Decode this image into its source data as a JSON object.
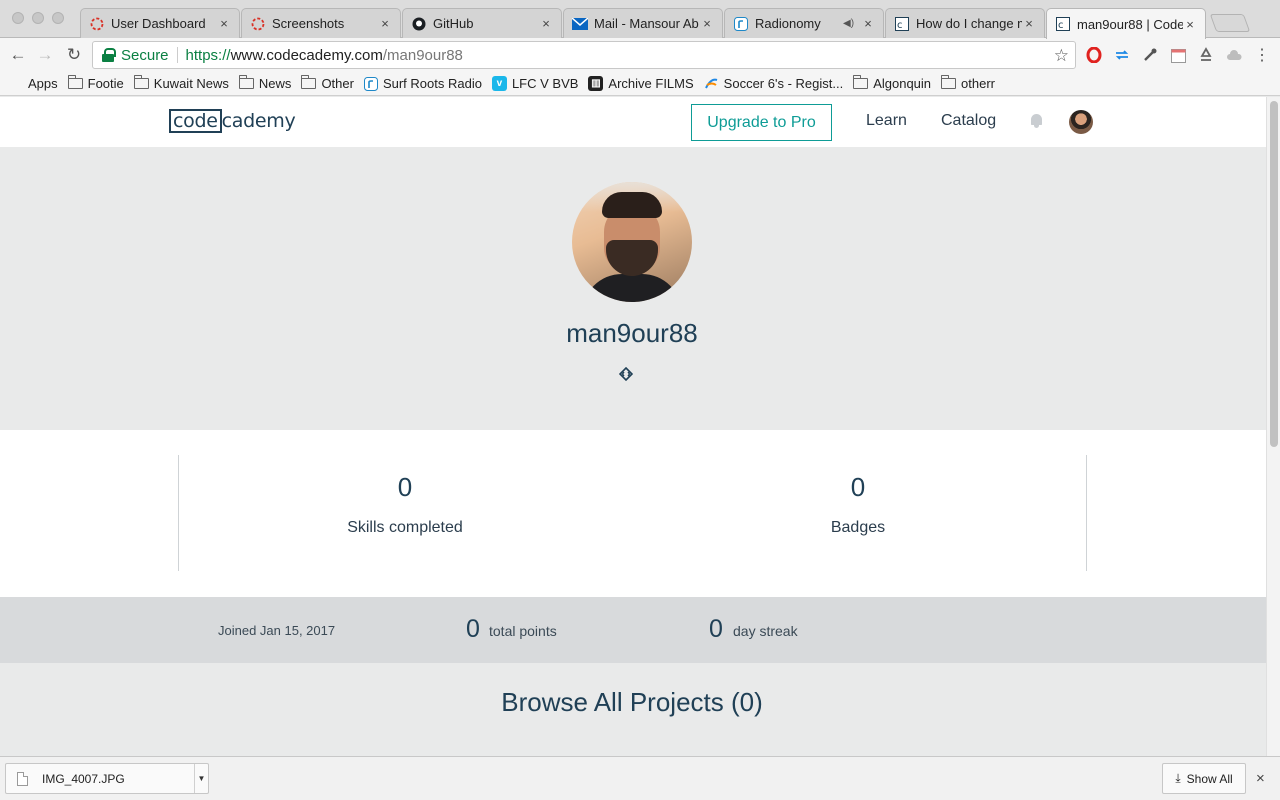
{
  "browser": {
    "tabs": [
      {
        "title": "User Dashboard",
        "icon": "spinner-icon"
      },
      {
        "title": "Screenshots",
        "icon": "spinner-icon"
      },
      {
        "title": "GitHub",
        "icon": "github-icon"
      },
      {
        "title": "Mail - Mansour Ab",
        "icon": "mail-icon"
      },
      {
        "title": "Radionomy",
        "icon": "radionomy-icon",
        "playing_audio": true
      },
      {
        "title": "How do I change m",
        "icon": "codecademy-icon"
      },
      {
        "title": "man9our88 | Code",
        "icon": "codecademy-icon",
        "active": true
      }
    ],
    "close_glyph": "×",
    "omnibox": {
      "secure_label": "Secure",
      "url_scheme": "https://",
      "url_host": "www.codecademy.com",
      "url_path": "/man9our88"
    },
    "bookmarks": [
      {
        "label": "Apps",
        "icon": "apps-grid-icon"
      },
      {
        "label": "Footie",
        "icon": "folder-icon"
      },
      {
        "label": "Kuwait News",
        "icon": "folder-icon"
      },
      {
        "label": "News",
        "icon": "folder-icon"
      },
      {
        "label": "Other",
        "icon": "folder-icon"
      },
      {
        "label": "Surf Roots Radio",
        "icon": "radionomy-icon"
      },
      {
        "label": "LFC V BVB",
        "icon": "vimeo-icon"
      },
      {
        "label": "Archive FILMS",
        "icon": "archive-icon"
      },
      {
        "label": "Soccer 6's - Regist...",
        "icon": "soccer6-icon"
      },
      {
        "label": "Algonquin",
        "icon": "folder-icon"
      },
      {
        "label": "otherr",
        "icon": "folder-icon"
      }
    ]
  },
  "site": {
    "logo": {
      "part1": "code",
      "part2": "cademy"
    },
    "upgrade_label": "Upgrade to Pro",
    "nav": {
      "learn": "Learn",
      "catalog": "Catalog"
    },
    "colors": {
      "brand": "#204056",
      "accent": "#0e9c96"
    }
  },
  "profile": {
    "username": "man9our88",
    "stats": [
      {
        "value": "0",
        "label": "Skills completed"
      },
      {
        "value": "0",
        "label": "Badges"
      }
    ],
    "joined": "Joined Jan 15, 2017",
    "total_points": {
      "value": "0",
      "label": "total points"
    },
    "day_streak": {
      "value": "0",
      "label": "day streak"
    },
    "browse_heading": "Browse All Projects (0)"
  },
  "downloads": {
    "file": "IMG_4007.JPG",
    "show_all": "Show All"
  }
}
